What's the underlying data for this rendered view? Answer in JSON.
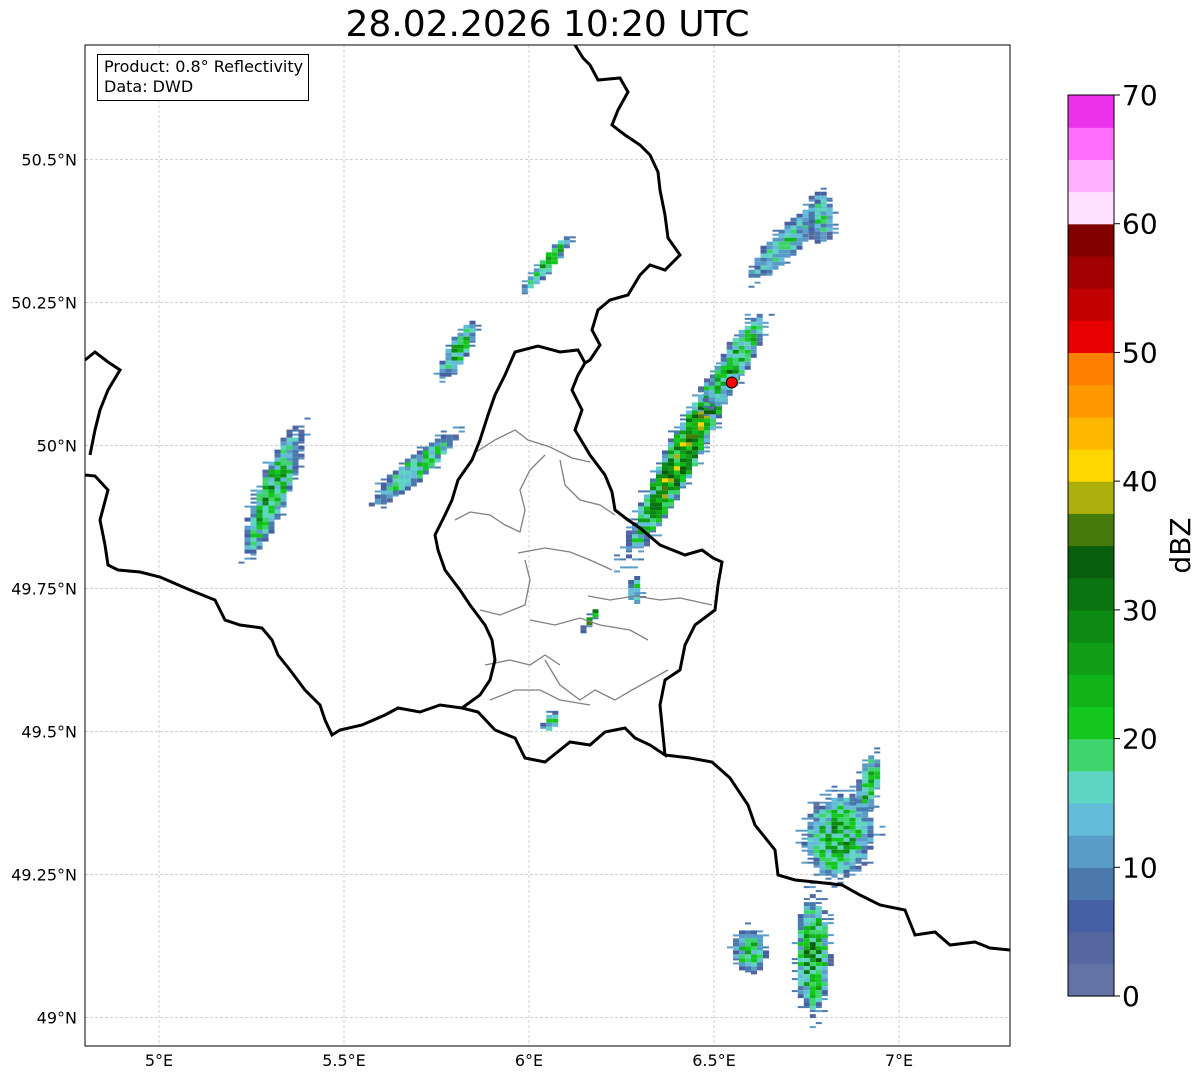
{
  "title": "28.02.2026 10:20 UTC",
  "info": {
    "product_line": "Product: 0.8° Reflectivity",
    "data_line": "Data: DWD"
  },
  "map": {
    "lon_range": [
      4.8,
      7.3
    ],
    "lat_range": [
      48.95,
      50.7
    ],
    "lon_ticks": [
      {
        "value": 5.0,
        "label": "5°E"
      },
      {
        "value": 5.5,
        "label": "5.5°E"
      },
      {
        "value": 6.0,
        "label": "6°E"
      },
      {
        "value": 6.5,
        "label": "6.5°E"
      },
      {
        "value": 7.0,
        "label": "7°E"
      }
    ],
    "lat_ticks": [
      {
        "value": 49.0,
        "label": "49°N"
      },
      {
        "value": 49.25,
        "label": "49.25°N"
      },
      {
        "value": 49.5,
        "label": "49.5°N"
      },
      {
        "value": 49.75,
        "label": "49.75°N"
      },
      {
        "value": 50.0,
        "label": "50°N"
      },
      {
        "value": 50.25,
        "label": "50.25°N"
      },
      {
        "value": 50.5,
        "label": "50.5°N"
      }
    ],
    "gridlines": true,
    "radar_site": {
      "lon": 6.548,
      "lat": 50.11,
      "color": "#ff0000"
    }
  },
  "echoes": [
    {
      "lon": 5.3,
      "lat": 49.92,
      "rx": 0.045,
      "ry": 0.13,
      "rot": 22,
      "peak": 22
    },
    {
      "lon": 5.68,
      "lat": 49.96,
      "rx": 0.035,
      "ry": 0.1,
      "rot": 50,
      "peak": 18
    },
    {
      "lon": 5.8,
      "lat": 50.17,
      "rx": 0.03,
      "ry": 0.06,
      "rot": 30,
      "peak": 20
    },
    {
      "lon": 6.04,
      "lat": 50.32,
      "rx": 0.02,
      "ry": 0.07,
      "rot": 40,
      "peak": 22
    },
    {
      "lon": 6.41,
      "lat": 49.99,
      "rx": 0.05,
      "ry": 0.22,
      "rot": 28,
      "peak": 33
    },
    {
      "lon": 6.55,
      "lat": 50.15,
      "rx": 0.04,
      "ry": 0.1,
      "rot": 30,
      "peak": 25
    },
    {
      "lon": 6.69,
      "lat": 50.36,
      "rx": 0.04,
      "ry": 0.1,
      "rot": 45,
      "peak": 15
    },
    {
      "lon": 6.78,
      "lat": 50.4,
      "rx": 0.04,
      "ry": 0.05,
      "rot": 0,
      "peak": 12
    },
    {
      "lon": 6.83,
      "lat": 49.32,
      "rx": 0.1,
      "ry": 0.08,
      "rot": 15,
      "peak": 22
    },
    {
      "lon": 6.76,
      "lat": 49.11,
      "rx": 0.05,
      "ry": 0.11,
      "rot": 0,
      "peak": 25
    },
    {
      "lon": 6.59,
      "lat": 49.12,
      "rx": 0.05,
      "ry": 0.04,
      "rot": 0,
      "peak": 18
    },
    {
      "lon": 6.91,
      "lat": 49.41,
      "rx": 0.03,
      "ry": 0.06,
      "rot": 10,
      "peak": 22
    },
    {
      "lon": 6.16,
      "lat": 49.7,
      "rx": 0.01,
      "ry": 0.03,
      "rot": 30,
      "peak": 30
    },
    {
      "lon": 6.05,
      "lat": 49.52,
      "rx": 0.02,
      "ry": 0.02,
      "rot": 40,
      "peak": 16
    },
    {
      "lon": 6.28,
      "lat": 49.75,
      "rx": 0.02,
      "ry": 0.025,
      "rot": 0,
      "peak": 14
    }
  ],
  "colorbar": {
    "label": "dBZ",
    "min": 0,
    "max": 70,
    "step": 2.5,
    "ticks": [
      0,
      10,
      20,
      30,
      40,
      50,
      60,
      70
    ],
    "colors": [
      "#6473a6",
      "#55679e",
      "#4560a3",
      "#4b78ad",
      "#5a9cc8",
      "#63bcd9",
      "#5ed4c2",
      "#3dd46e",
      "#14c81e",
      "#11b51a",
      "#109e16",
      "#0c8a12",
      "#0a7410",
      "#085e0c",
      "#467a0a",
      "#adb00c",
      "#ffd700",
      "#ffb800",
      "#ff9800",
      "#ff7f00",
      "#e60000",
      "#c20000",
      "#a10000",
      "#800000",
      "#ffe0ff",
      "#ffb0ff",
      "#ff6eff",
      "#ec32ec"
    ]
  }
}
